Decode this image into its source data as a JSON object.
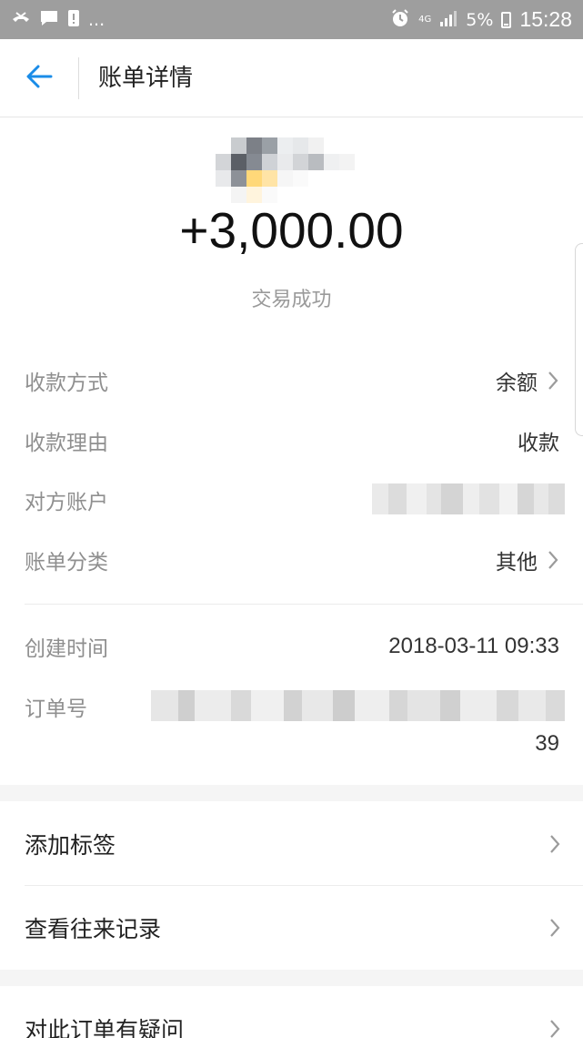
{
  "status_bar": {
    "battery": "5%",
    "time": "15:28",
    "network": "4G",
    "dots": "...",
    "icons": [
      "missed-call-icon",
      "message-icon",
      "notification-icon",
      "alarm-icon",
      "signal-icon",
      "battery-icon"
    ]
  },
  "header": {
    "title": "账单详情",
    "back_icon": "arrow-left-icon"
  },
  "colors": {
    "accent": "#1a8ce8",
    "label": "#8f8f8f",
    "value": "#333333",
    "divider": "#ececec"
  },
  "summary": {
    "amount": "+3,000.00",
    "status": "交易成功"
  },
  "details": [
    {
      "label": "收款方式",
      "value": "余额",
      "has_chevron": true
    },
    {
      "label": "收款理由",
      "value": "收款",
      "has_chevron": false
    },
    {
      "label": "对方账户",
      "value": "",
      "has_chevron": false
    },
    {
      "label": "账单分类",
      "value": "其他",
      "has_chevron": true
    }
  ],
  "details2": [
    {
      "label": "创建时间",
      "value": "2018-03-11 09:33"
    },
    {
      "label": "订单号",
      "value": "39"
    }
  ],
  "actions": {
    "add_tag": "添加标签",
    "view_history": "查看往来记录",
    "question": "对此订单有疑问"
  }
}
